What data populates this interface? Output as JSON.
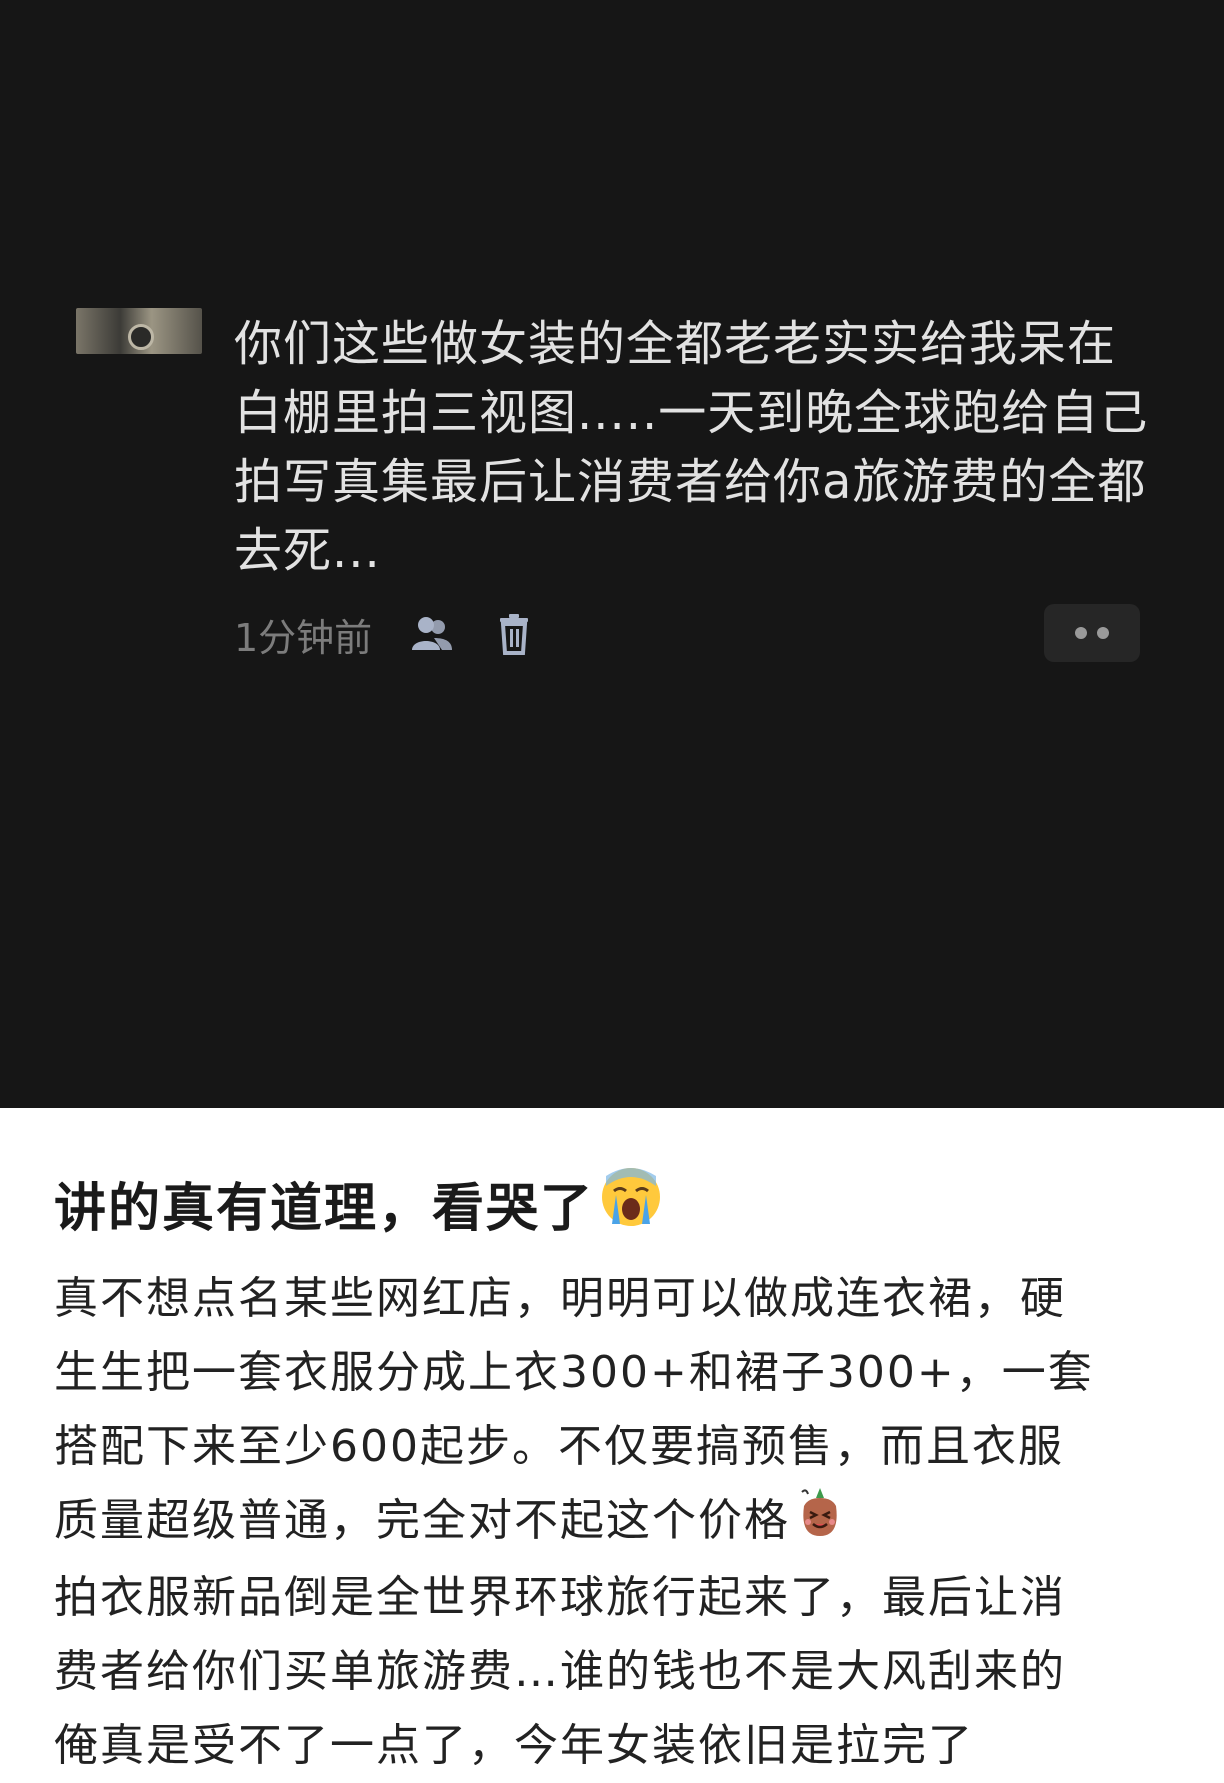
{
  "comment": {
    "text": "你们这些做女装的全都老老实实给我呆在白棚里拍三视图.....一天到晚全球跑给自己拍写真集最后让消费者给你a旅游费的全都去死...",
    "timestamp": "1分钟前",
    "icons": [
      "user-icon",
      "trash-icon",
      "more-icon"
    ]
  },
  "post": {
    "title": "讲的真有道理，看哭了",
    "title_emoji": "crying-face-emoji",
    "lines": [
      "真不想点名某些网红店，明明可以做成连衣裙，硬",
      "生生把一套衣服分成上衣300+和裙子300+，一套",
      "搭配下来至少600起步。不仅要搞预售，而且衣服",
      "质量超级普通，完全对不起这个价格",
      "拍衣服新品倒是全世界环球旅行起来了，最后让消",
      "费者给你们买单旅游费…谁的钱也不是大风刮来的",
      "俺真是受不了一点了，今年女装依旧是拉完了"
    ],
    "line4_emoji": "annoyed-sack-emoji"
  },
  "colors": {
    "dark_background": "#161616",
    "comment_text": "#e2e2e2",
    "meta_text": "#7c7c7c",
    "icon": "#a9b3c8",
    "light_background": "#ffffff",
    "post_text": "#222222"
  }
}
